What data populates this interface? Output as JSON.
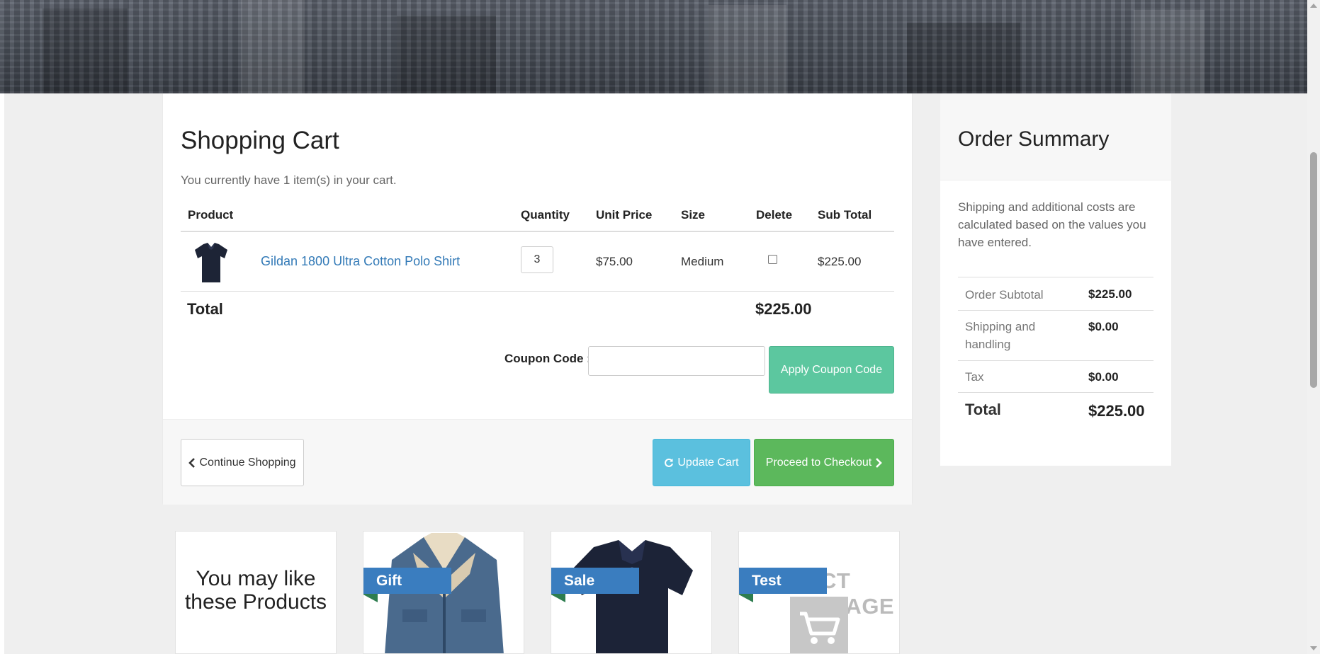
{
  "cart": {
    "title": "Shopping Cart",
    "summary_text": "You currently have 1 item(s) in your cart.",
    "columns": {
      "product": "Product",
      "quantity": "Quantity",
      "unit_price": "Unit Price",
      "size": "Size",
      "delete": "Delete",
      "subtotal": "Sub Total"
    },
    "items": [
      {
        "name": "Gildan 1800 Ultra Cotton Polo Shirt",
        "quantity": "3",
        "unit_price": "$75.00",
        "size": "Medium",
        "delete_checked": false,
        "subtotal": "$225.00"
      }
    ],
    "total_label": "Total",
    "total_value": "$225.00",
    "coupon_label": "Coupon Code :",
    "coupon_value": "",
    "apply_coupon_label": "Apply Coupon Code",
    "continue_label": "Continue Shopping",
    "update_label": "Update Cart",
    "checkout_label": "Proceed to Checkout"
  },
  "order_summary": {
    "title": "Order Summary",
    "note": "Shipping and additional costs are calculated based on the values you have entered.",
    "rows": [
      {
        "label": "Order Subtotal",
        "value": "$225.00"
      },
      {
        "label": "Shipping and handling",
        "value": "$0.00"
      },
      {
        "label": "Tax",
        "value": "$0.00"
      }
    ],
    "total_label": "Total",
    "total_value": "$225.00"
  },
  "recommendations": {
    "title": "You may like these Products",
    "products": [
      {
        "badge": "Gift",
        "image": "denim-jacket"
      },
      {
        "badge": "Sale",
        "image": "polo-shirt"
      },
      {
        "badge": "Test",
        "image": "placeholder",
        "placeholder_text": "CT IMAGE"
      }
    ]
  },
  "colors": {
    "link": "#337ab7",
    "coupon_button": "#5cc79f",
    "update_button": "#5bc0de",
    "checkout_button": "#5cb85c",
    "badge": "#3a7dbf"
  },
  "icons": {
    "continue": "chevron-left-icon",
    "update": "refresh-icon",
    "checkout": "chevron-right-icon",
    "placeholder": "cart-icon"
  }
}
